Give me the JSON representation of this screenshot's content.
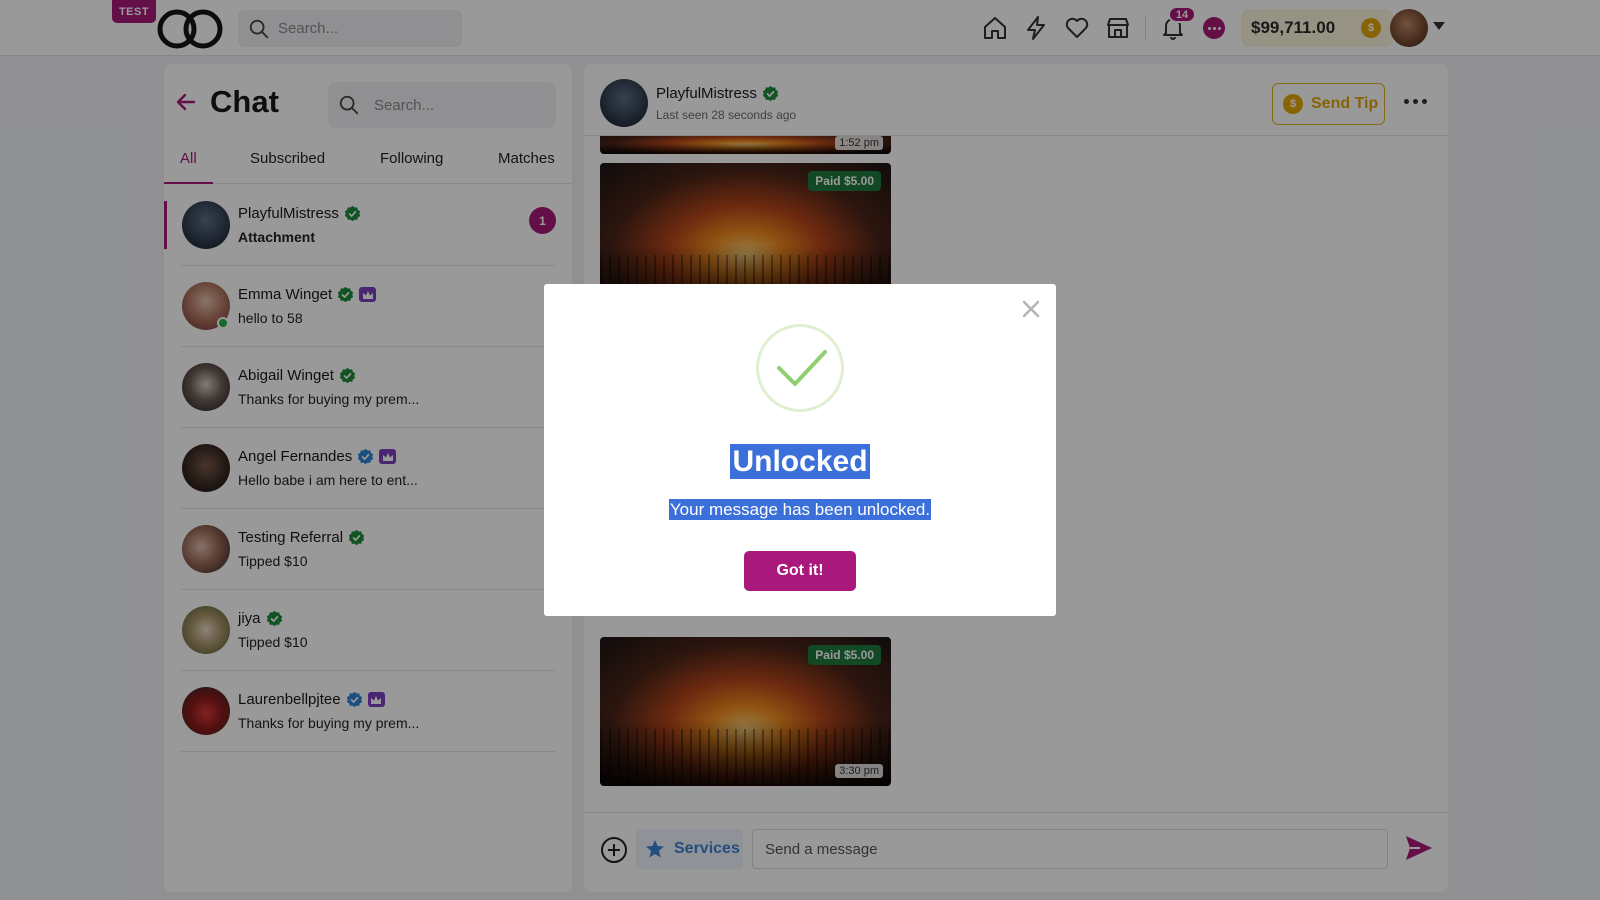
{
  "topbar": {
    "env_badge": "TEST",
    "search_placeholder": "Search...",
    "notification_count": "14",
    "balance": "$99,711.00",
    "nav_icons": [
      "home-icon",
      "bolt-icon",
      "heart-icon",
      "store-icon",
      "bell-icon",
      "chat-icon"
    ]
  },
  "chat": {
    "title": "Chat",
    "search_placeholder": "Search...",
    "tabs": [
      {
        "label": "All",
        "active": true
      },
      {
        "label": "Subscribed",
        "active": false
      },
      {
        "label": "Following",
        "active": false
      },
      {
        "label": "Matches",
        "active": false
      }
    ],
    "conversations": [
      {
        "name": "PlayfulMistress",
        "preview": "Attachment",
        "verified": "green",
        "crown": false,
        "unread": "1",
        "online": false
      },
      {
        "name": "Emma Winget",
        "preview": "hello to 58",
        "verified": "green",
        "crown": true,
        "online": true
      },
      {
        "name": "Abigail Winget",
        "preview": "Thanks for buying my prem...",
        "verified": "green",
        "crown": false,
        "online": false
      },
      {
        "name": "Angel Fernandes",
        "preview": "Hello babe i am here to ent...",
        "verified": "blue",
        "crown": true,
        "online": false
      },
      {
        "name": "Testing Referral",
        "preview": "Tipped $10",
        "verified": "green",
        "crown": false,
        "online": false
      },
      {
        "name": "jiya",
        "preview": "Tipped $10",
        "verified": "green",
        "crown": false,
        "online": false
      },
      {
        "name": "Laurenbellpjtee",
        "preview": "Thanks for buying my prem...",
        "verified": "blue",
        "crown": true,
        "online": false
      }
    ]
  },
  "conversation": {
    "name": "PlayfulMistress",
    "status": "Last seen 28 seconds ago",
    "send_tip_label": "Send Tip",
    "messages": [
      {
        "time": "1:52 pm"
      },
      {
        "paid": "Paid $5.00"
      },
      {
        "paid": "Paid $5.00",
        "time": "3:30 pm"
      }
    ],
    "composer": {
      "services_label": "Services",
      "placeholder": "Send a message"
    }
  },
  "modal": {
    "title": "Unlocked",
    "message": "Your message has been unlocked.",
    "button_label": "Got it!"
  },
  "colors": {
    "brand": "#a8197b",
    "verified_green": "#1f8a3d",
    "verified_blue": "#2d84d6",
    "tip_gold": "#e3a50b",
    "selection_blue": "#3b6fd9"
  }
}
